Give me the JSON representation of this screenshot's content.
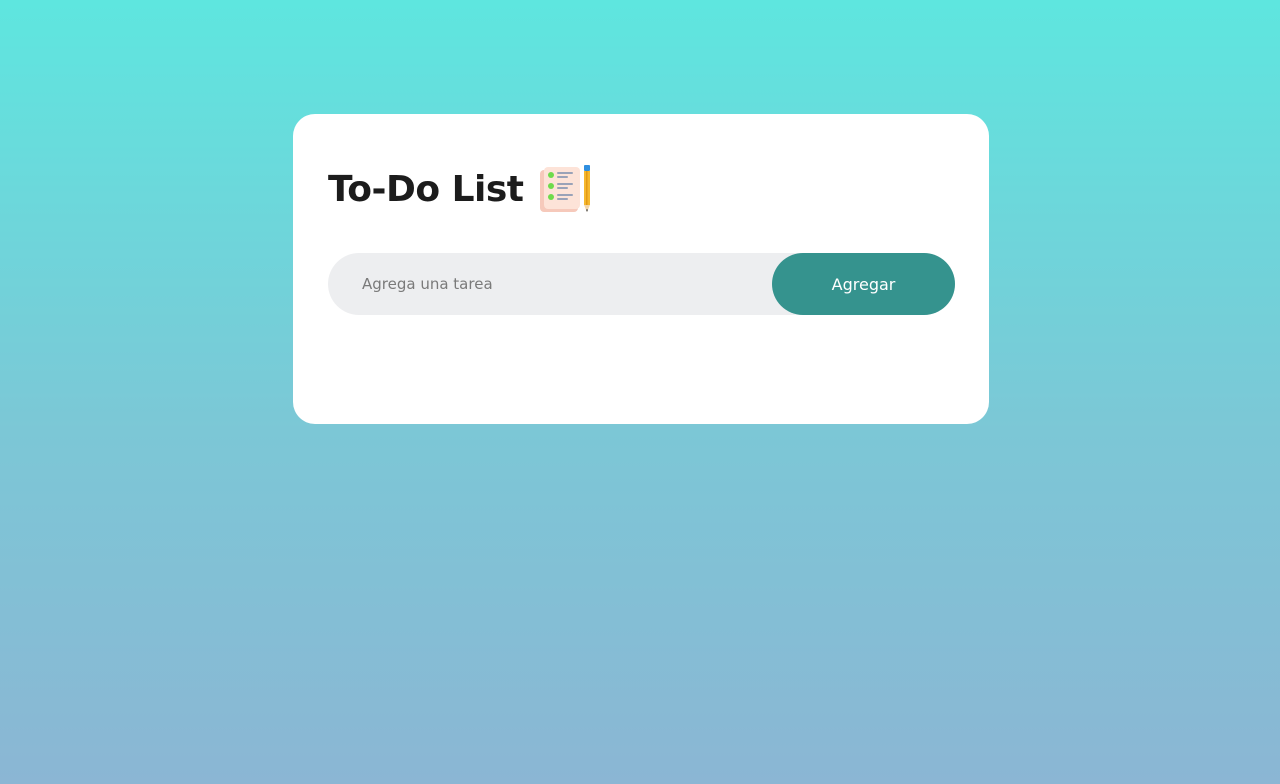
{
  "app": {
    "title": "To-Do List",
    "title_icon": "checklist-pencil-icon"
  },
  "task_input": {
    "placeholder": "Agrega una tarea",
    "value": ""
  },
  "add_button": {
    "label": "Agregar"
  },
  "tasks": [],
  "colors": {
    "background_top": "#5ee6df",
    "background_bottom": "#8bb6d4",
    "card": "#ffffff",
    "input_bg": "#edeef0",
    "button": "#35938e",
    "button_text": "#ffffff",
    "title_text": "#1c1c1c"
  }
}
